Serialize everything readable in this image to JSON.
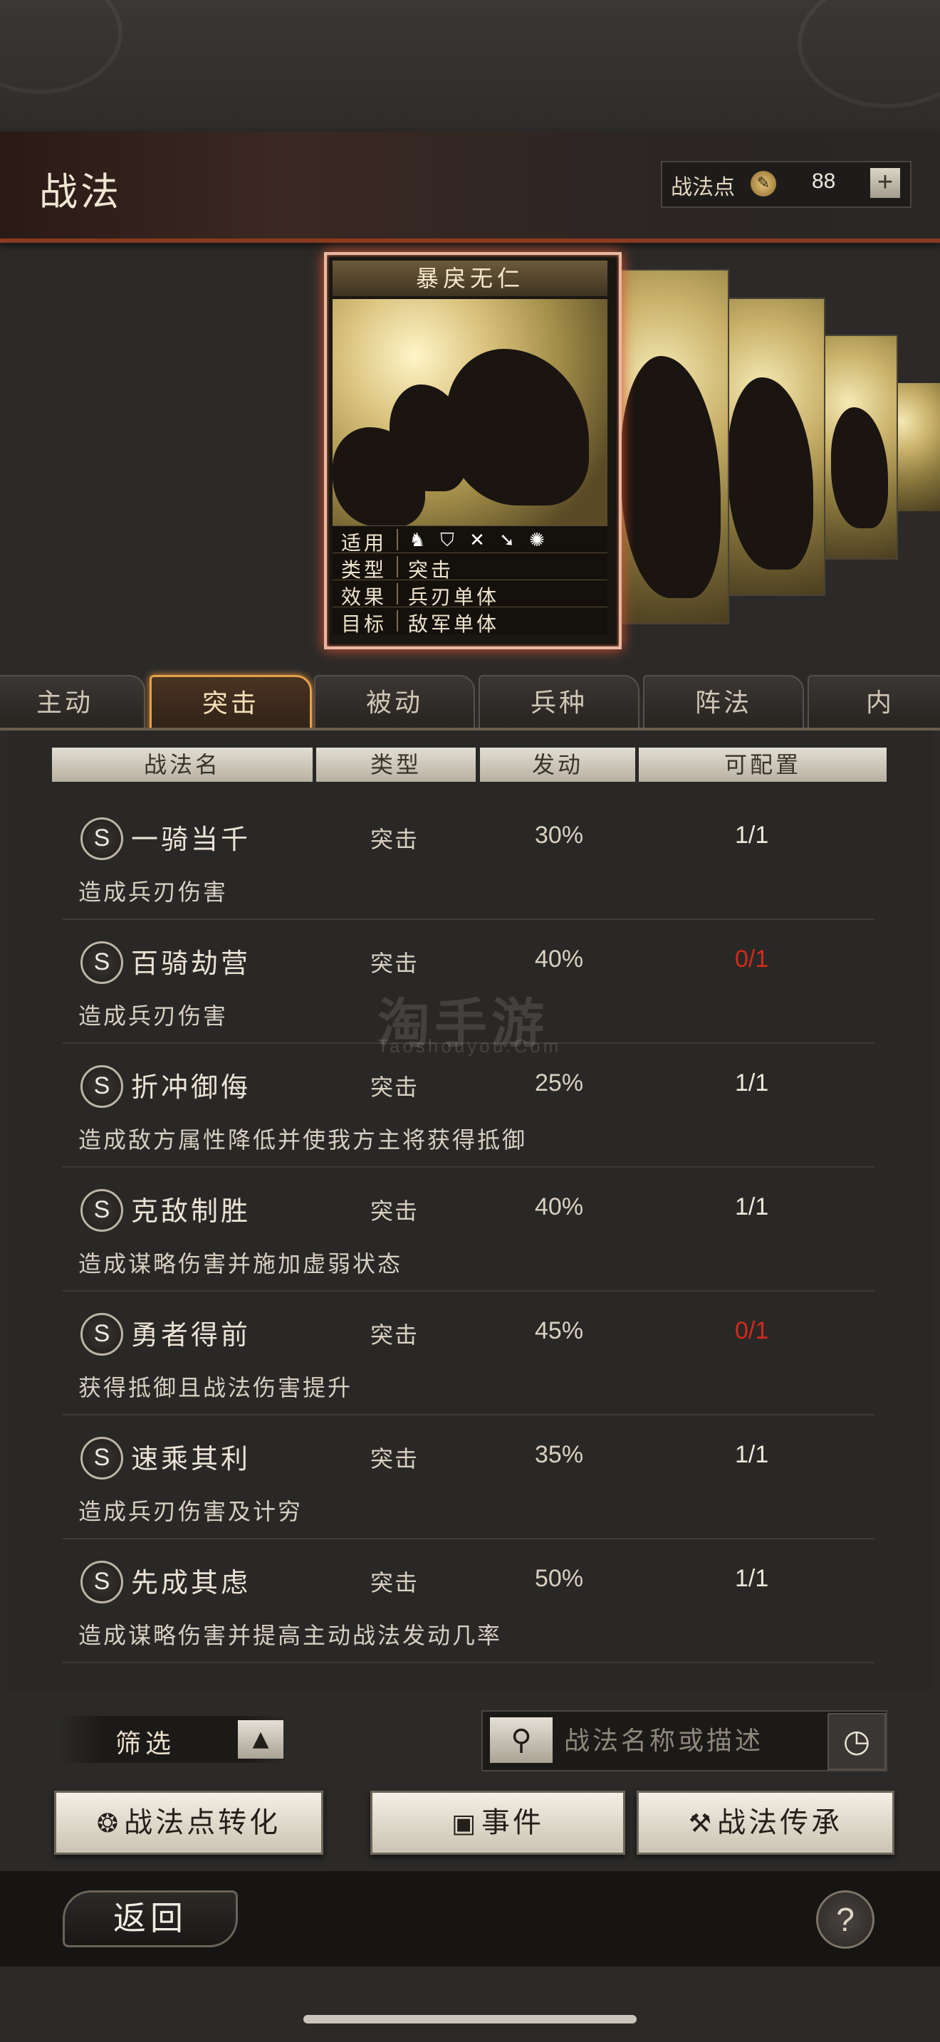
{
  "header": {
    "title": "战法",
    "points_label": "战法点",
    "points_value": "88",
    "plus": "+"
  },
  "featured_card": {
    "name": "暴戾无仁",
    "rows": [
      {
        "key": "适用",
        "value": ""
      },
      {
        "key": "类型",
        "value": "突击"
      },
      {
        "key": "效果",
        "value": "兵刃单体"
      },
      {
        "key": "目标",
        "value": "敌军单体"
      }
    ],
    "icons": [
      "cavalry-icon",
      "shield-icon",
      "bow-icon",
      "spear-icon",
      "wheel-icon"
    ]
  },
  "tabs": [
    {
      "label": "主动"
    },
    {
      "label": "突击",
      "active": true
    },
    {
      "label": "被动"
    },
    {
      "label": "兵种"
    },
    {
      "label": "阵法"
    },
    {
      "label": "内"
    }
  ],
  "table": {
    "headers": [
      "战法名",
      "类型",
      "发动",
      "可配置"
    ],
    "rows": [
      {
        "grade": "S",
        "name": "一骑当千",
        "type": "突击",
        "rate": "30%",
        "config": "1/1",
        "desc": "造成兵刃伤害"
      },
      {
        "grade": "S",
        "name": "百骑劫营",
        "type": "突击",
        "rate": "40%",
        "config": "0/1",
        "desc": "造成兵刃伤害"
      },
      {
        "grade": "S",
        "name": "折冲御侮",
        "type": "突击",
        "rate": "25%",
        "config": "1/1",
        "desc": "造成敌方属性降低并使我方主将获得抵御"
      },
      {
        "grade": "S",
        "name": "克敌制胜",
        "type": "突击",
        "rate": "40%",
        "config": "1/1",
        "desc": "造成谋略伤害并施加虚弱状态"
      },
      {
        "grade": "S",
        "name": "勇者得前",
        "type": "突击",
        "rate": "45%",
        "config": "0/1",
        "desc": "获得抵御且战法伤害提升"
      },
      {
        "grade": "S",
        "name": "速乘其利",
        "type": "突击",
        "rate": "35%",
        "config": "1/1",
        "desc": "造成兵刃伤害及计穷"
      },
      {
        "grade": "S",
        "name": "先成其虑",
        "type": "突击",
        "rate": "50%",
        "config": "1/1",
        "desc": "造成谋略伤害并提高主动战法发动几率"
      }
    ]
  },
  "watermark": {
    "main": "淘手游",
    "sub": "Taoshouyou.Com"
  },
  "controls": {
    "filter_label": "筛选",
    "search_placeholder": "战法名称或描述",
    "btn_convert": "战法点转化",
    "btn_event": "事件",
    "btn_inherit": "战法传承"
  },
  "footer": {
    "back": "返回",
    "help": "?"
  },
  "colors": {
    "accent": "#e3a14c",
    "red": "#d42a1a",
    "header_line": "#8a3a22"
  }
}
